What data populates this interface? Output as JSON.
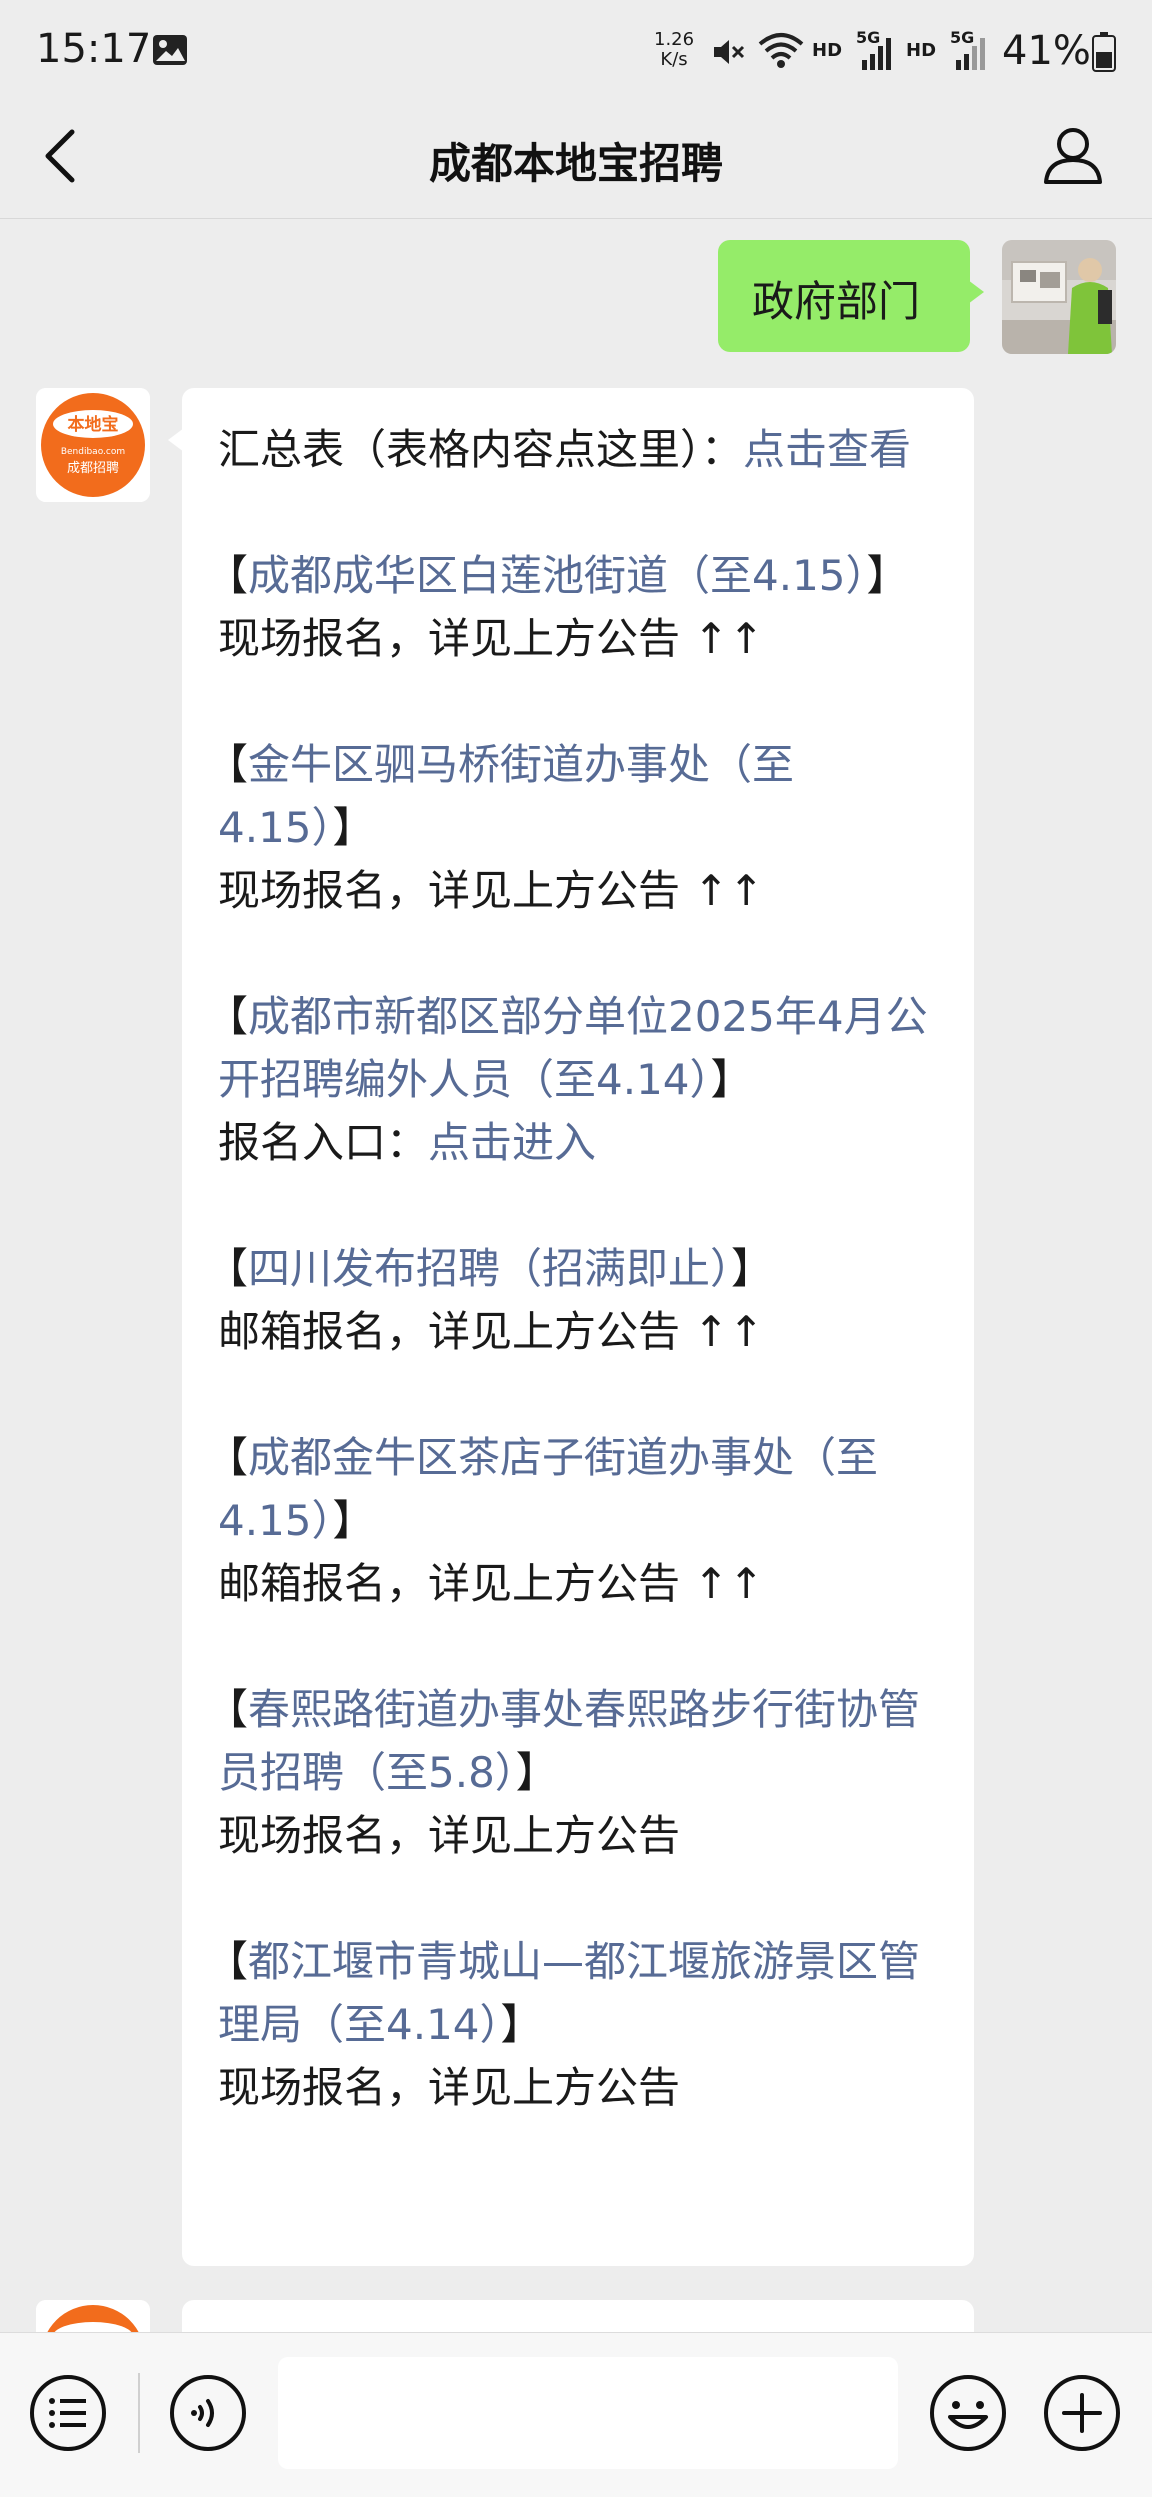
{
  "status_bar": {
    "time": "15:17",
    "net_speed_value": "1.26",
    "net_speed_unit": "K/s",
    "hd1": "HD",
    "net1": "5G",
    "hd2": "HD",
    "net2": "5G",
    "battery": "41%"
  },
  "nav": {
    "title": "成都本地宝招聘"
  },
  "sent": {
    "text": "政府部门"
  },
  "bot": {
    "avatar_text_top": "本地宝",
    "avatar_text_url": "Bendibao.com",
    "avatar_text_bottom": "成都招聘"
  },
  "message": {
    "summary_label": "汇总表（表格内容点这里）：",
    "summary_link": "点击查看",
    "items": [
      {
        "open": "【",
        "title": "成都成华区白莲池街道（至4.15）",
        "close": "】",
        "note": "现场报名，详见上方公告 ↑↑"
      },
      {
        "open": "【",
        "title": "金牛区驷马桥街道办事处（至4.15）",
        "close": "】",
        "note": "现场报名，详见上方公告 ↑↑"
      },
      {
        "open": "【",
        "title": "成都市新都区部分单位2025年4月公开招聘编外人员（至4.14）",
        "close": "】",
        "note_label": "报名入口：",
        "note_link": "点击进入"
      },
      {
        "open": "【",
        "title": "四川发布招聘（招满即止）",
        "close": "】",
        "note": "邮箱报名，详见上方公告 ↑↑"
      },
      {
        "open": "【",
        "title": "成都金牛区茶店子街道办事处（至4.15）",
        "close": "】",
        "note": "邮箱报名，详见上方公告 ↑↑"
      },
      {
        "open": "【",
        "title": "春熙路街道办事处春熙路步行街协管员招聘（至5.8）",
        "close": "】",
        "note": "现场报名，详见上方公告"
      },
      {
        "open": "【",
        "title": "都江堰市青城山—都江堰旅游景区管理局（至4.14）",
        "close": "】",
        "note": "现场报名，详见上方公告"
      }
    ]
  },
  "colors": {
    "sent_bubble": "#95ec69",
    "link": "#576b95",
    "background": "#ededed",
    "brand_orange": "#f26c1c"
  },
  "icons": [
    "image-icon",
    "mute-icon",
    "wifi-icon",
    "signal-icon",
    "battery-icon",
    "back-icon",
    "user-icon",
    "list-menu-icon",
    "voice-icon",
    "emoji-icon",
    "add-icon"
  ]
}
